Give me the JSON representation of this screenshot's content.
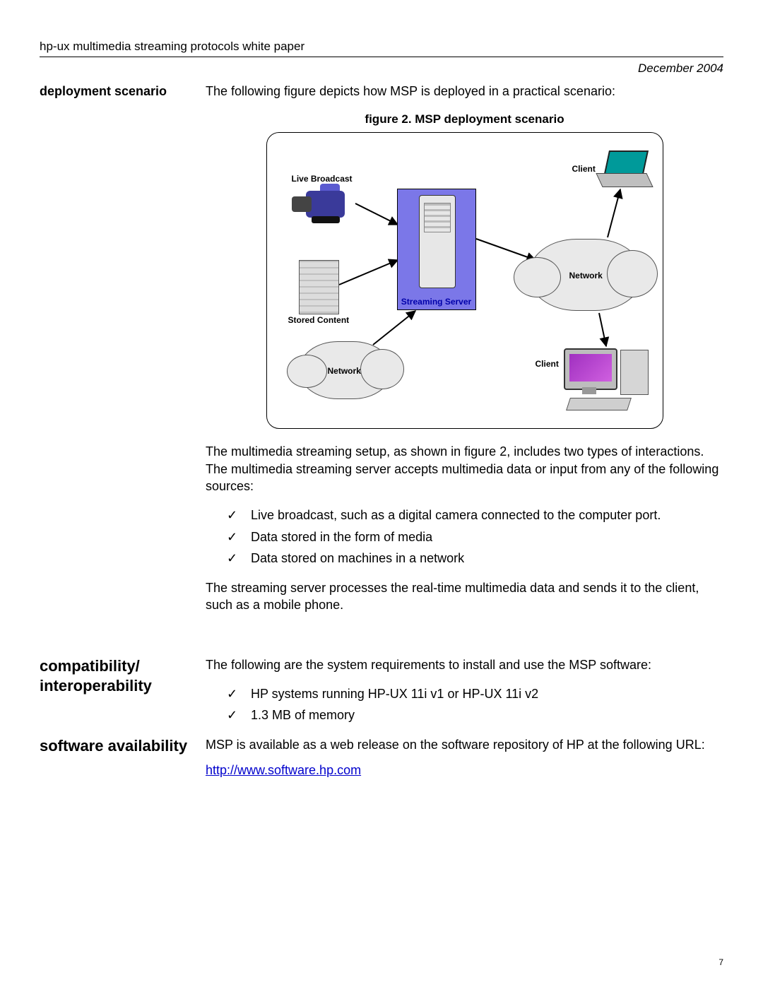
{
  "header": {
    "title": "hp-ux multimedia streaming protocols white paper",
    "date": "December 2004"
  },
  "section1": {
    "heading": "deployment scenario",
    "intro": "The following figure depicts how MSP is deployed in a practical scenario:",
    "figure_caption": "figure 2. MSP deployment scenario",
    "diagram": {
      "live_broadcast": "Live Broadcast",
      "stored_content": "Stored Content",
      "streaming_server": "Streaming Server",
      "network": "Network",
      "client": "Client"
    },
    "para2": "The multimedia streaming setup, as shown in figure 2, includes two types of interactions. The multimedia streaming server accepts multimedia data or input from any of the following sources:",
    "bullets": [
      "Live broadcast, such as a digital camera connected to the computer port.",
      "Data stored in the form of media",
      "Data stored on machines in a network"
    ],
    "para3": "The streaming server processes the real-time multimedia data and sends it to the client, such as a mobile phone."
  },
  "section2": {
    "heading": "compatibility/ interoperability",
    "intro": "The following are the system requirements to install and use the MSP software:",
    "bullets": [
      "HP systems running HP-UX 11i v1 or HP-UX 11i v2",
      "1.3 MB of memory"
    ]
  },
  "section3": {
    "heading": "software availability",
    "intro": "MSP is available as a web release on the software repository of HP at the following URL:",
    "url": "http://www.software.hp.com"
  },
  "page_number": "7"
}
